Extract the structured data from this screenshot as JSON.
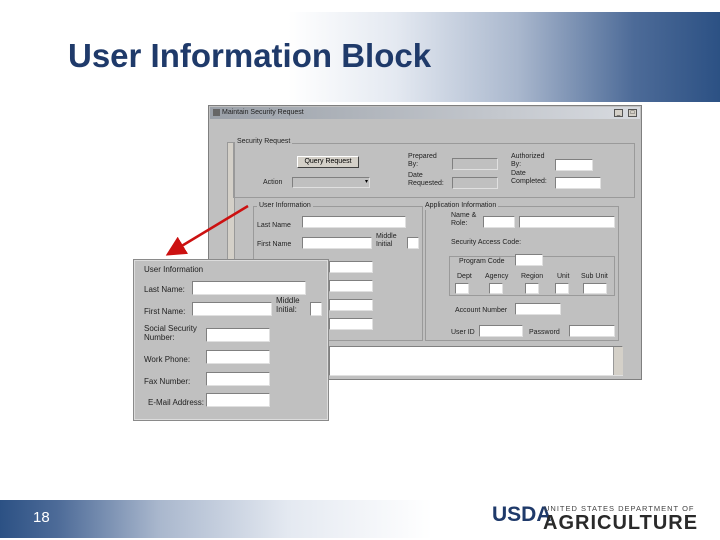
{
  "slide": {
    "title": "User Information Block",
    "page_number": "18",
    "logo": {
      "mark": "USDA",
      "top_line": "UNITED STATES DEPARTMENT OF",
      "bottom_line": "AGRICULTURE"
    }
  },
  "window": {
    "title": "Maintain Security Request",
    "security_request": {
      "group_label": "Security Request",
      "query_button": "Query Request",
      "action_label": "Action",
      "prepared_by_label": "Prepared By:",
      "date_requested_label": "Date Requested:",
      "authorized_by_label": "Authorized By:",
      "date_completed_label": "Date Completed:"
    },
    "user_info": {
      "group_label": "User Information",
      "last_name_label": "Last Name",
      "first_name_label": "First Name",
      "middle_initial_label": "Middle Initial"
    },
    "app_info": {
      "group_label": "Application Information",
      "name_role_label": "Name & Role:",
      "security_access_label": "Security Access Code:",
      "program_code_label": "Program Code",
      "columns": [
        "Dept",
        "Agency",
        "Region",
        "Unit",
        "Sub Unit"
      ],
      "account_number_label": "Account Number",
      "user_id_label": "User ID",
      "password_label": "Password"
    }
  },
  "zoom": {
    "group_label": "User Information",
    "last_name": "Last Name:",
    "first_name": "First Name:",
    "middle_initial": "Middle Initial:",
    "ssn": "Social Security Number:",
    "work_phone": "Work Phone:",
    "fax_number": "Fax Number:",
    "email": "E-Mail Address:"
  },
  "colors": {
    "title": "#1f3a6a",
    "arrow": "#cc1111",
    "band": "#2c5184"
  }
}
